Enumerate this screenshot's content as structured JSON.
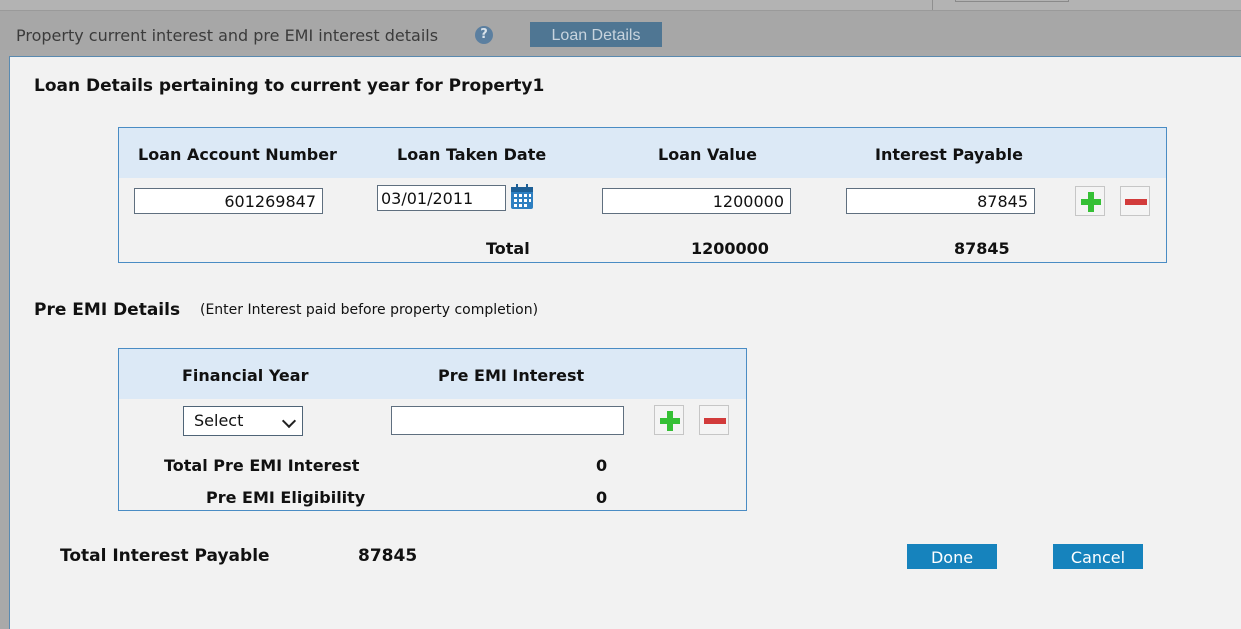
{
  "background": {
    "title": "Property current interest and pre EMI interest details",
    "loan_details_button": "Loan Details"
  },
  "modal": {
    "title": "Loan Details pertaining to current year for Property1",
    "loan_table": {
      "headers": [
        "Loan Account Number",
        "Loan Taken Date",
        "Loan Value",
        "Interest Payable"
      ],
      "row": {
        "account_number": "601269847",
        "taken_date": "03/01/2011",
        "loan_value": "1200000",
        "interest_payable": "87845"
      },
      "total_label": "Total",
      "total_loan_value": "1200000",
      "total_interest_payable": "87845"
    },
    "pre_emi": {
      "title": "Pre EMI Details",
      "note": "(Enter Interest paid before property completion)",
      "headers": [
        "Financial Year",
        "Pre EMI Interest"
      ],
      "financial_year_selected": "Select",
      "pre_emi_interest_value": "",
      "total_label": "Total Pre EMI Interest",
      "total_value": "0",
      "eligibility_label": "Pre EMI Eligibility",
      "eligibility_value": "0"
    },
    "total_interest_label": "Total Interest Payable",
    "total_interest_value": "87845",
    "done_label": "Done",
    "cancel_label": "Cancel"
  }
}
